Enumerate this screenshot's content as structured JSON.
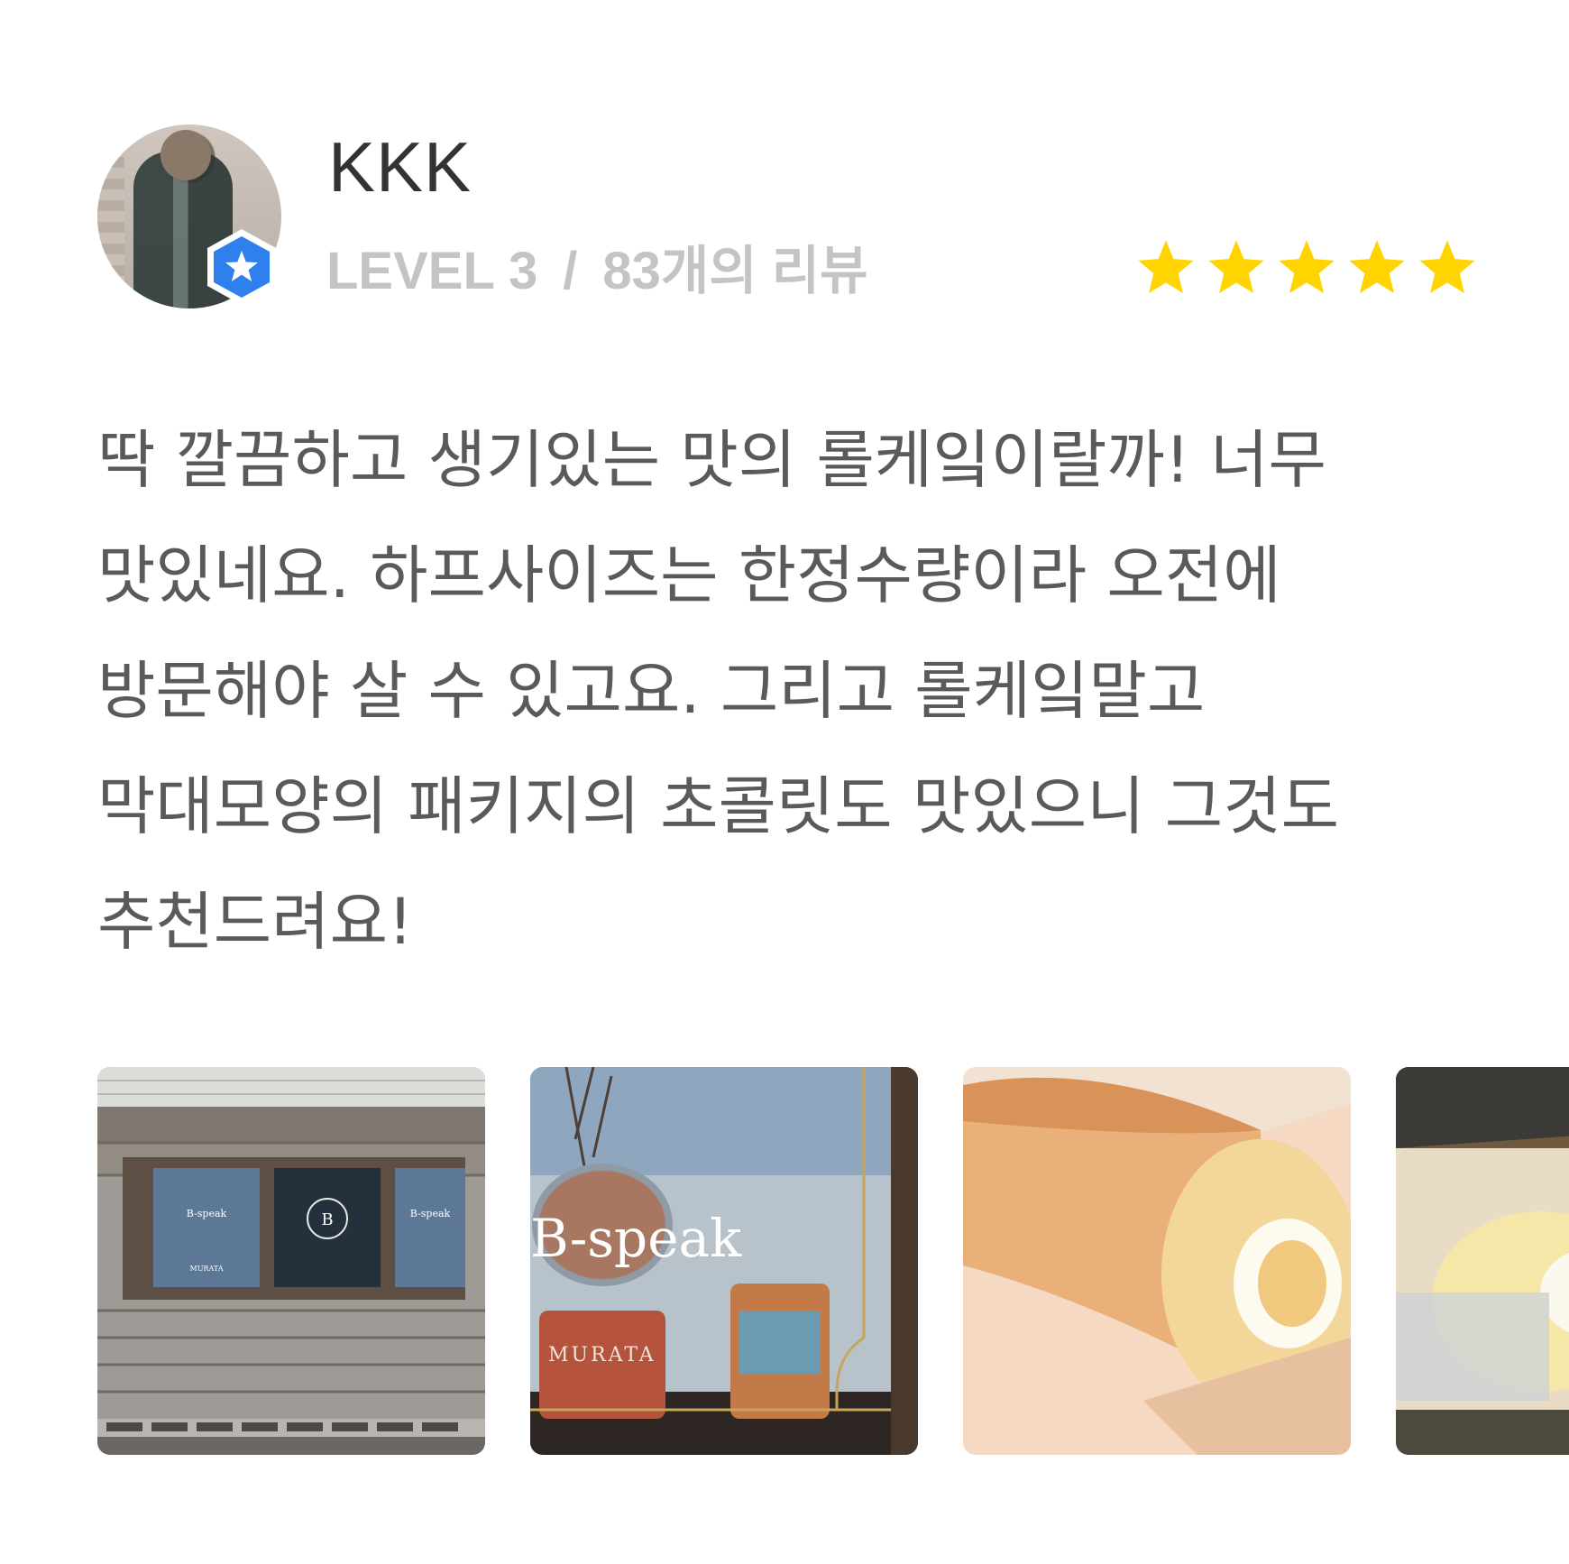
{
  "review": {
    "user": {
      "name": "KKK",
      "level": "LEVEL 3",
      "separator": "/",
      "review_count": "83개의 리뷰",
      "avatar_icon": "user-avatar",
      "badge_icon": "level-star-badge-icon"
    },
    "rating": {
      "value": 5,
      "max": 5,
      "star_color": "#FFD400"
    },
    "text": "딱 깔끔하고 생기있는 맛의 롤케잌이랄까! 너무 맛있네요. 하프사이즈는 한정수량이라 오전에 방문해야 살 수 있고요. 그리고 롤케잌말고 막대모양의 패키지의 초콜릿도 맛있으니 그것도 추천드려요!",
    "photos": {
      "shop_front": {
        "sign_text": "B-speak",
        "brand_text": "MURATA"
      },
      "window": {
        "sign_text": "B-speak",
        "brand_text": "MURATA"
      },
      "roll_cake": {},
      "roll_cake_box": {}
    }
  },
  "colors": {
    "name": "#333333",
    "meta": "#c4c4c4",
    "body": "#5a5a5a",
    "badge": "#2f80ed"
  }
}
